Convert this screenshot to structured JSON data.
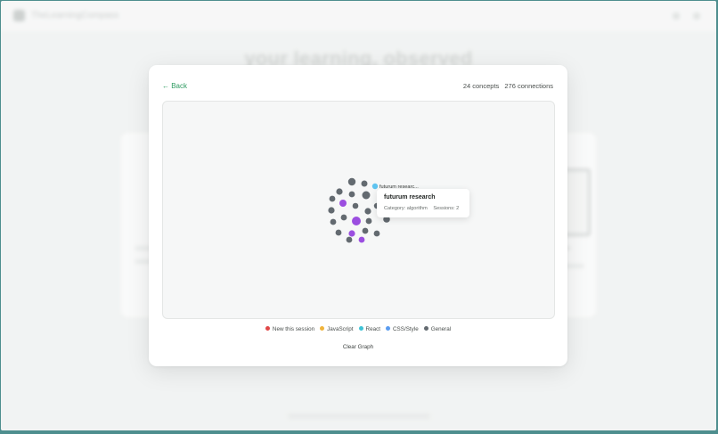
{
  "background": {
    "brand": "TheLearningCompass",
    "hero_title": "your learning, observed"
  },
  "modal": {
    "back_label": "← Back",
    "concepts": "24 concepts",
    "connections": "276 connections",
    "node_label": "futurum researc...",
    "tooltip": {
      "title": "futurum research",
      "category": "Category: algorithm",
      "sessions": "Sessions: 2"
    },
    "legend": [
      {
        "label": "New this session",
        "color": "#e04848"
      },
      {
        "label": "JavaScript",
        "color": "#f0b43c"
      },
      {
        "label": "React",
        "color": "#3ec3d6"
      },
      {
        "label": "CSS/Style",
        "color": "#5a9cf0"
      },
      {
        "label": "General",
        "color": "#636a70"
      }
    ],
    "clear_label": "Clear Graph"
  },
  "graph": {
    "nodes": [
      {
        "color": "#636a70",
        "r": 4.2
      },
      {
        "color": "#636a70",
        "r": 3.5
      },
      {
        "color": "#5fc4f0",
        "r": 3.2
      },
      {
        "color": "#636a70",
        "r": 3.6
      },
      {
        "color": "#636a70",
        "r": 4.5
      },
      {
        "color": "#636a70",
        "r": 3.4
      },
      {
        "color": "#636a70",
        "r": 3.4
      },
      {
        "color": "#636a70",
        "r": 3.2
      },
      {
        "color": "#636a70",
        "r": 3.6
      },
      {
        "color": "#636a70",
        "r": 3.3
      },
      {
        "color": "#9b4ee0",
        "r": 4.0
      },
      {
        "color": "#636a70",
        "r": 3.6
      },
      {
        "color": "#636a70",
        "r": 3.4
      },
      {
        "color": "#9b4ee0",
        "r": 3.6
      },
      {
        "color": "#636a70",
        "r": 3.4
      },
      {
        "color": "#636a70",
        "r": 3.8
      },
      {
        "color": "#636a70",
        "r": 3.4
      },
      {
        "color": "#636a70",
        "r": 3.4
      },
      {
        "color": "#636a70",
        "r": 3.4
      },
      {
        "color": "#9b4ee0",
        "r": 5.0
      },
      {
        "color": "#636a70",
        "r": 3.4
      },
      {
        "color": "#636a70",
        "r": 3.8
      },
      {
        "color": "#9b4ee0",
        "r": 3.4
      },
      {
        "color": "#636a70",
        "r": 3.4
      }
    ]
  }
}
